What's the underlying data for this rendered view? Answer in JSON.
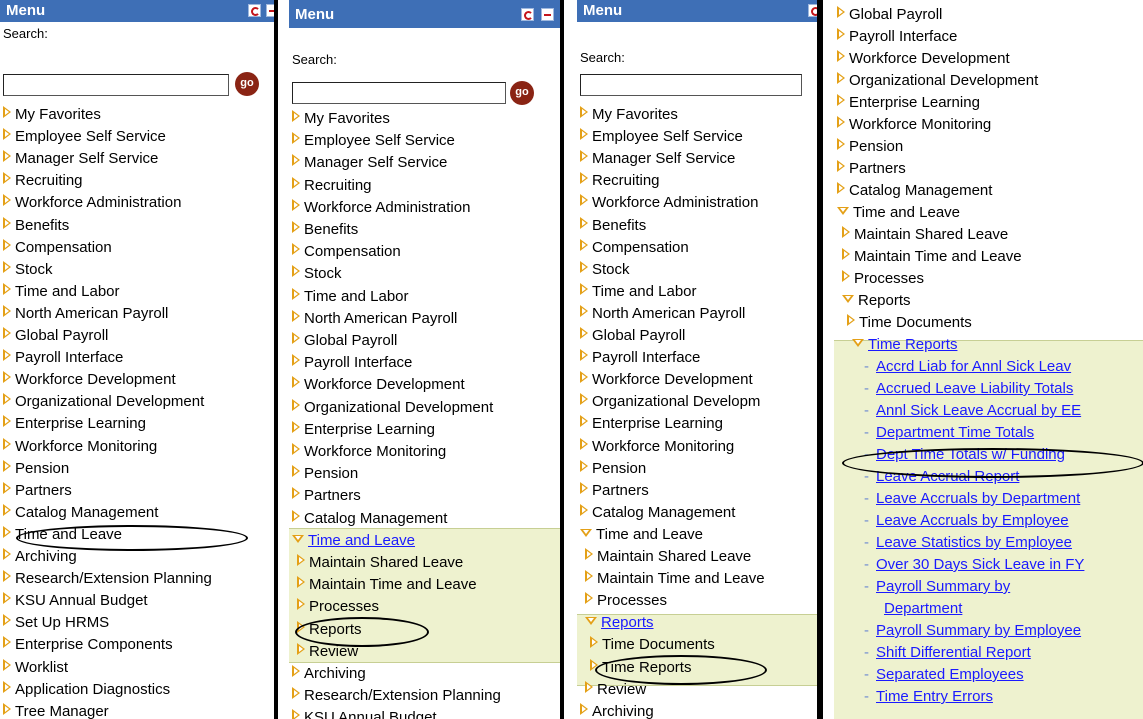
{
  "menu_title": "Menu",
  "search_label": "Search:",
  "go_label": "go",
  "panel1": [
    "My Favorites",
    "Employee Self Service",
    "Manager Self Service",
    "Recruiting",
    "Workforce Administration",
    "Benefits",
    "Compensation",
    "Stock",
    "Time and Labor",
    "North American Payroll",
    "Global Payroll",
    "Payroll Interface",
    "Workforce Development",
    "Organizational Development",
    "Enterprise Learning",
    "Workforce Monitoring",
    "Pension",
    "Partners",
    "Catalog Management",
    "Time and Leave",
    "Archiving",
    "Research/Extension Planning",
    "KSU Annual Budget",
    "Set Up HRMS",
    "Enterprise Components",
    "Worklist",
    "Application Diagnostics",
    "Tree Manager"
  ],
  "panel2": [
    "My Favorites",
    "Employee Self Service",
    "Manager Self Service",
    "Recruiting",
    "Workforce Administration",
    "Benefits",
    "Compensation",
    "Stock",
    "Time and Labor",
    "North American Payroll",
    "Global Payroll",
    "Payroll Interface",
    "Workforce Development",
    "Organizational Development",
    "Enterprise Learning",
    "Workforce Monitoring",
    "Pension",
    "Partners",
    "Catalog Management",
    "Time and Leave",
    "Maintain Shared Leave",
    "Maintain Time and Leave",
    "Processes",
    "Reports",
    "Review",
    "Archiving",
    "Research/Extension Planning",
    "KSU Annual Budget"
  ],
  "panel3": [
    "My Favorites",
    "Employee Self Service",
    "Manager Self Service",
    "Recruiting",
    "Workforce Administration",
    "Benefits",
    "Compensation",
    "Stock",
    "Time and Labor",
    "North American Payroll",
    "Global Payroll",
    "Payroll Interface",
    "Workforce Development",
    "Organizational Developm",
    "Enterprise Learning",
    "Workforce Monitoring",
    "Pension",
    "Partners",
    "Catalog Management",
    "Time and Leave",
    "Maintain Shared Leave",
    "Maintain Time and Leave",
    "Processes",
    "Reports",
    "Time Documents",
    "Time Reports",
    "Review",
    "Archiving"
  ],
  "panel4": [
    "Global Payroll",
    "Payroll Interface",
    "Workforce Development",
    "Organizational Development",
    "Enterprise Learning",
    "Workforce Monitoring",
    "Pension",
    "Partners",
    "Catalog Management",
    "Time and Leave",
    "Maintain Shared Leave",
    "Maintain Time and Leave",
    "Processes",
    "Reports",
    "Time Documents",
    "Time Reports",
    "Accrd Liab for Annl Sick Leav",
    "Accrued Leave Liability Totals",
    "Annl Sick Leave Accrual by EE",
    "Department Time Totals",
    "Dept Time Totals w/ Funding",
    "Leave Accrual Report",
    "Leave Accruals by Department",
    "Leave Accruals by Employee",
    "Leave Statistics by Employee",
    "Over 30 Days Sick Leave in FY",
    "Payroll Summary by",
    "Department",
    "Payroll Summary by Employee",
    "Shift Differential Report",
    "Separated Employees",
    "Time Entry Errors"
  ]
}
